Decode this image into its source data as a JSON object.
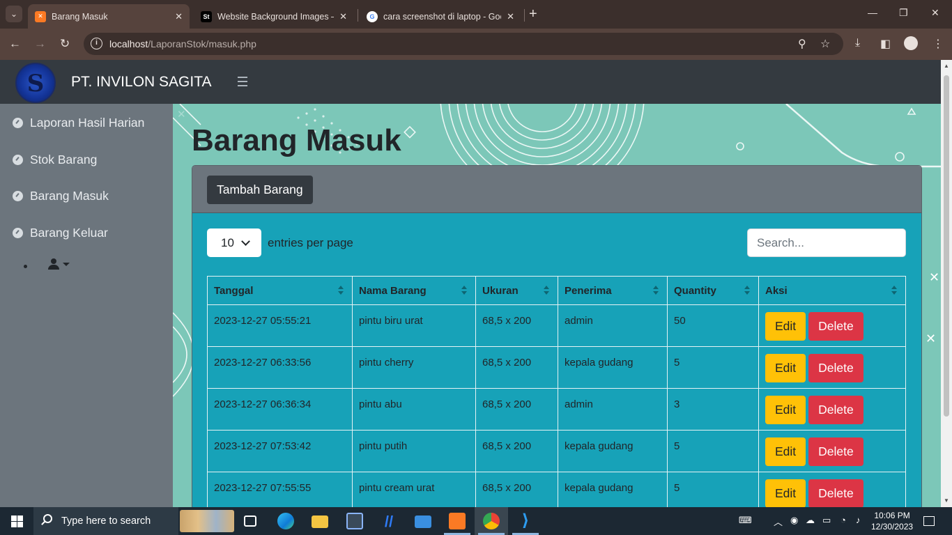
{
  "browser": {
    "tabs": [
      {
        "title": "Barang Masuk",
        "favicon": "xampp-icon",
        "active": true
      },
      {
        "title": "Website Background Images – I",
        "favicon": "st-icon",
        "active": false
      },
      {
        "title": "cara screenshot di laptop - Goo",
        "favicon": "google-icon",
        "active": false
      }
    ],
    "url_host": "localhost",
    "url_path": "/LaporanStok/masuk.php"
  },
  "navbar": {
    "brand": "PT. INVILON SAGITA",
    "logo_letter": "S"
  },
  "sidebar": {
    "items": [
      {
        "label": "Laporan Hasil Harian"
      },
      {
        "label": "Stok Barang"
      },
      {
        "label": "Barang Masuk"
      },
      {
        "label": "Barang Keluar"
      }
    ]
  },
  "page": {
    "title": "Barang Masuk",
    "add_button": "Tambah Barang",
    "entries_value": "10",
    "entries_label": "entries per page",
    "search_placeholder": "Search..."
  },
  "table": {
    "columns": [
      "Tanggal",
      "Nama Barang",
      "Ukuran",
      "Penerima",
      "Quantity",
      "Aksi"
    ],
    "edit_label": "Edit",
    "delete_label": "Delete",
    "rows": [
      {
        "tanggal": "2023-12-27 05:55:21",
        "nama": "pintu biru urat",
        "ukuran": "68,5 x 200",
        "penerima": "admin",
        "qty": "50"
      },
      {
        "tanggal": "2023-12-27 06:33:56",
        "nama": "pintu cherry",
        "ukuran": "68,5 x 200",
        "penerima": "kepala gudang",
        "qty": "5"
      },
      {
        "tanggal": "2023-12-27 06:36:34",
        "nama": "pintu abu",
        "ukuran": "68,5 x 200",
        "penerima": "admin",
        "qty": "3"
      },
      {
        "tanggal": "2023-12-27 07:53:42",
        "nama": "pintu putih",
        "ukuran": "68,5 x 200",
        "penerima": "kepala gudang",
        "qty": "5"
      },
      {
        "tanggal": "2023-12-27 07:55:55",
        "nama": "pintu cream urat",
        "ukuran": "68,5 x 200",
        "penerima": "kepala gudang",
        "qty": "5"
      }
    ]
  },
  "taskbar": {
    "search_text": "Type here to search",
    "time": "10:06 PM",
    "date": "12/30/2023"
  },
  "colors": {
    "navbar": "#343a40",
    "sidebar": "#6c757d",
    "card_body": "#17a2b8",
    "edit_button": "#ffc107",
    "delete_button": "#dc3545",
    "background_mint": "#7cc7b8"
  }
}
